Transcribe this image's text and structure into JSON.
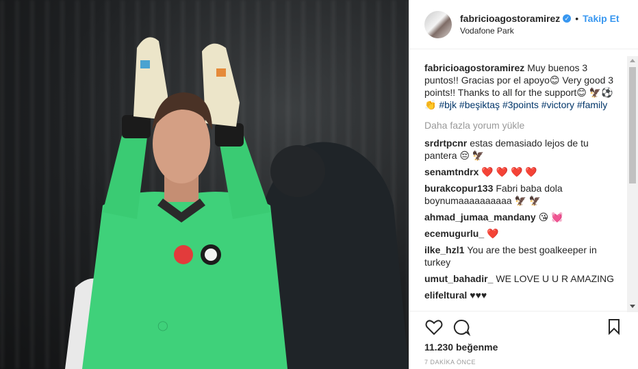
{
  "post": {
    "username": "fabricioagostoramirez",
    "verified_mark": "✓",
    "separator": "•",
    "follow_label": "Takip Et",
    "location": "Vodafone Park",
    "caption_user": "fabricioagostoramirez",
    "caption_text": "Muy buenos 3 puntos!! Gracias por el apoyo😊 Very good 3 points!! Thanks to all for the support😊 🦅⚽👏",
    "caption_tags": [
      "#bjk",
      "#beşiktaş",
      "#3points",
      "#victory",
      "#family"
    ],
    "load_more": "Daha fazla yorum yükle",
    "comments": [
      {
        "user": "srdrtpcnr",
        "text": "estas demasiado lejos de tu pantera 😔 🦅"
      },
      {
        "user": "senamtndrx",
        "text": "❤️ ❤️ ❤️ ❤️"
      },
      {
        "user": "burakcopur133",
        "text": "Fabri baba dola boynumaaaaaaaaaa 🦅 🦅"
      },
      {
        "user": "ahmad_jumaa_mandany",
        "text": "😘 💓"
      },
      {
        "user": "ecemugurlu_",
        "text": "❤️"
      },
      {
        "user": "ilke_hzl1",
        "text": "You are the best goalkeeper in turkey"
      },
      {
        "user": "umut_bahadir_",
        "text": "WE LOVE U U R AMAZING"
      },
      {
        "user": "elifeltural",
        "text": "♥♥♥"
      }
    ],
    "likes": "11.230 beğenme",
    "timestamp": "7 DAKİKA ÖNCE",
    "icons": {
      "like": "heart-icon",
      "comment": "comment-icon",
      "save": "bookmark-icon",
      "verified": "verified-badge-icon"
    },
    "colors": {
      "link": "#3897f0",
      "hashtag": "#003569",
      "jersey": "#3fd17a"
    }
  }
}
